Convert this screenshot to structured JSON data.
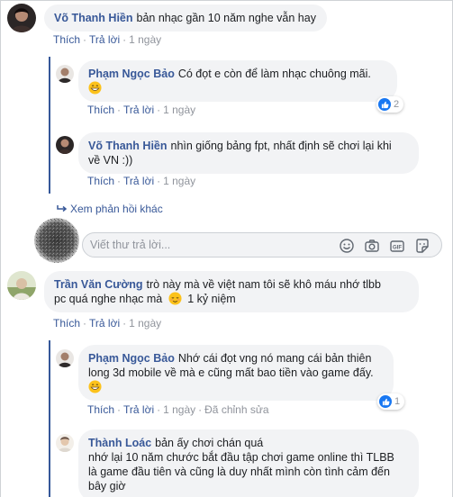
{
  "labels": {
    "like": "Thích",
    "reply": "Trả lời",
    "dot": "·",
    "edited": "Đã chỉnh sửa",
    "more_replies": "Xem phản hồi khác",
    "reply_placeholder": "Viết thư trả lời..."
  },
  "comments": [
    {
      "author": "Võ Thanh Hiền",
      "text": "bản nhạc gần 10 năm nghe vẫn hay",
      "time": "1 ngày"
    },
    {
      "author": "Phạm Ngọc Bảo",
      "text": "Có đọt e còn để làm nhạc chuông mãi.",
      "emoji": "grinning-face",
      "time": "1 ngày",
      "reaction_count": "2"
    },
    {
      "author": "Võ Thanh Hiền",
      "text1": "nhìn giống bảng fpt, nhất định sẽ chơi lại khi",
      "text2": "về VN :))",
      "time": "1 ngày"
    },
    {
      "author": "Trần Văn Cường",
      "text1": "trò này mà về việt nam tôi sẽ khô máu nhớ tlbb",
      "text2": "pc quá nghe nhạc mà",
      "text2b": "1 kỷ niệm",
      "emoji": "relieved-face",
      "time": "1 ngày"
    },
    {
      "author": "Phạm Ngọc Bảo",
      "text1": "Nhớ cái đọt vng nó mang cái bản thiên",
      "text2": "long 3d mobile về mà e cũng mất bao tiền vào game đấy.",
      "emoji": "grinning-face",
      "time": "1 ngày",
      "reaction_count": "1"
    },
    {
      "author": "Thành Loác",
      "text1": "bản ấy chơi chán quá",
      "text2": "nhớ lại 10 năm chước bắt đầu tập chơi game online thì TLBB",
      "text3": "là game đầu tiên và cũng là duy nhất mình còn tình cảm đến",
      "text4": "bây giờ"
    }
  ],
  "colors": {
    "link": "#385898",
    "bubble": "#f2f3f5",
    "meta": "#90949c",
    "like": "#1877f2"
  },
  "icons": [
    "reply-arrow-icon",
    "smiley-icon",
    "camera-icon",
    "gif-icon",
    "sticker-icon",
    "like-reaction-icon"
  ]
}
